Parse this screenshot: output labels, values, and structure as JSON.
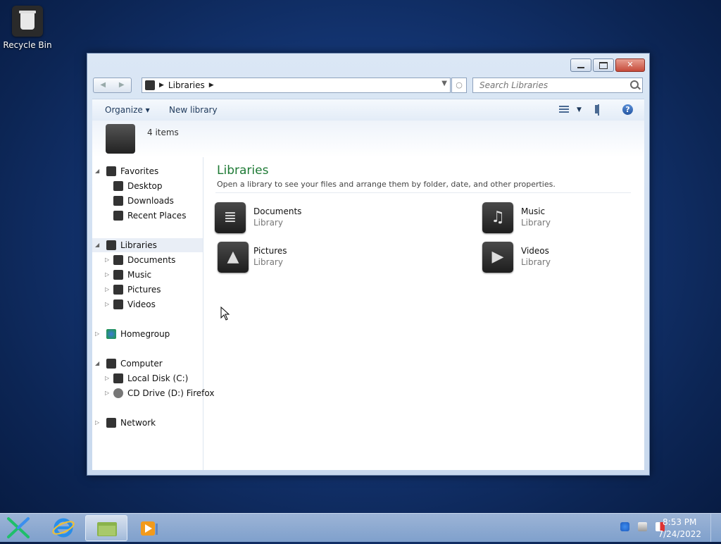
{
  "desktop": {
    "recycle_bin_label": "Recycle Bin"
  },
  "window": {
    "address": {
      "breadcrumb": "Libraries"
    },
    "search": {
      "placeholder": "Search Libraries"
    },
    "toolbar": {
      "organize_label": "Organize ▾",
      "new_library_label": "New library"
    },
    "details": {
      "items_count": "4 items"
    },
    "nav_tree": {
      "favorites": {
        "label": "Favorites",
        "items": [
          "Desktop",
          "Downloads",
          "Recent Places"
        ]
      },
      "libraries": {
        "label": "Libraries",
        "items": [
          "Documents",
          "Music",
          "Pictures",
          "Videos"
        ]
      },
      "homegroup": {
        "label": "Homegroup"
      },
      "computer": {
        "label": "Computer",
        "items": [
          "Local Disk (C:)",
          "CD Drive (D:) Firefox"
        ]
      },
      "network": {
        "label": "Network"
      }
    },
    "main": {
      "title": "Libraries",
      "description": "Open a library to see your files and arrange them by folder, date, and other properties.",
      "libraries": [
        {
          "name": "Documents",
          "type": "Library",
          "icon": "documents-icon"
        },
        {
          "name": "Music",
          "type": "Library",
          "icon": "music-icon"
        },
        {
          "name": "Pictures",
          "type": "Library",
          "icon": "pictures-icon"
        },
        {
          "name": "Videos",
          "type": "Library",
          "icon": "videos-icon"
        }
      ]
    }
  },
  "taskbar": {
    "clock": {
      "time": "8:53 PM",
      "date": "7/24/2022"
    }
  },
  "colors": {
    "title_green": "#1e7a35",
    "desktop_blue": "#163a7c"
  }
}
